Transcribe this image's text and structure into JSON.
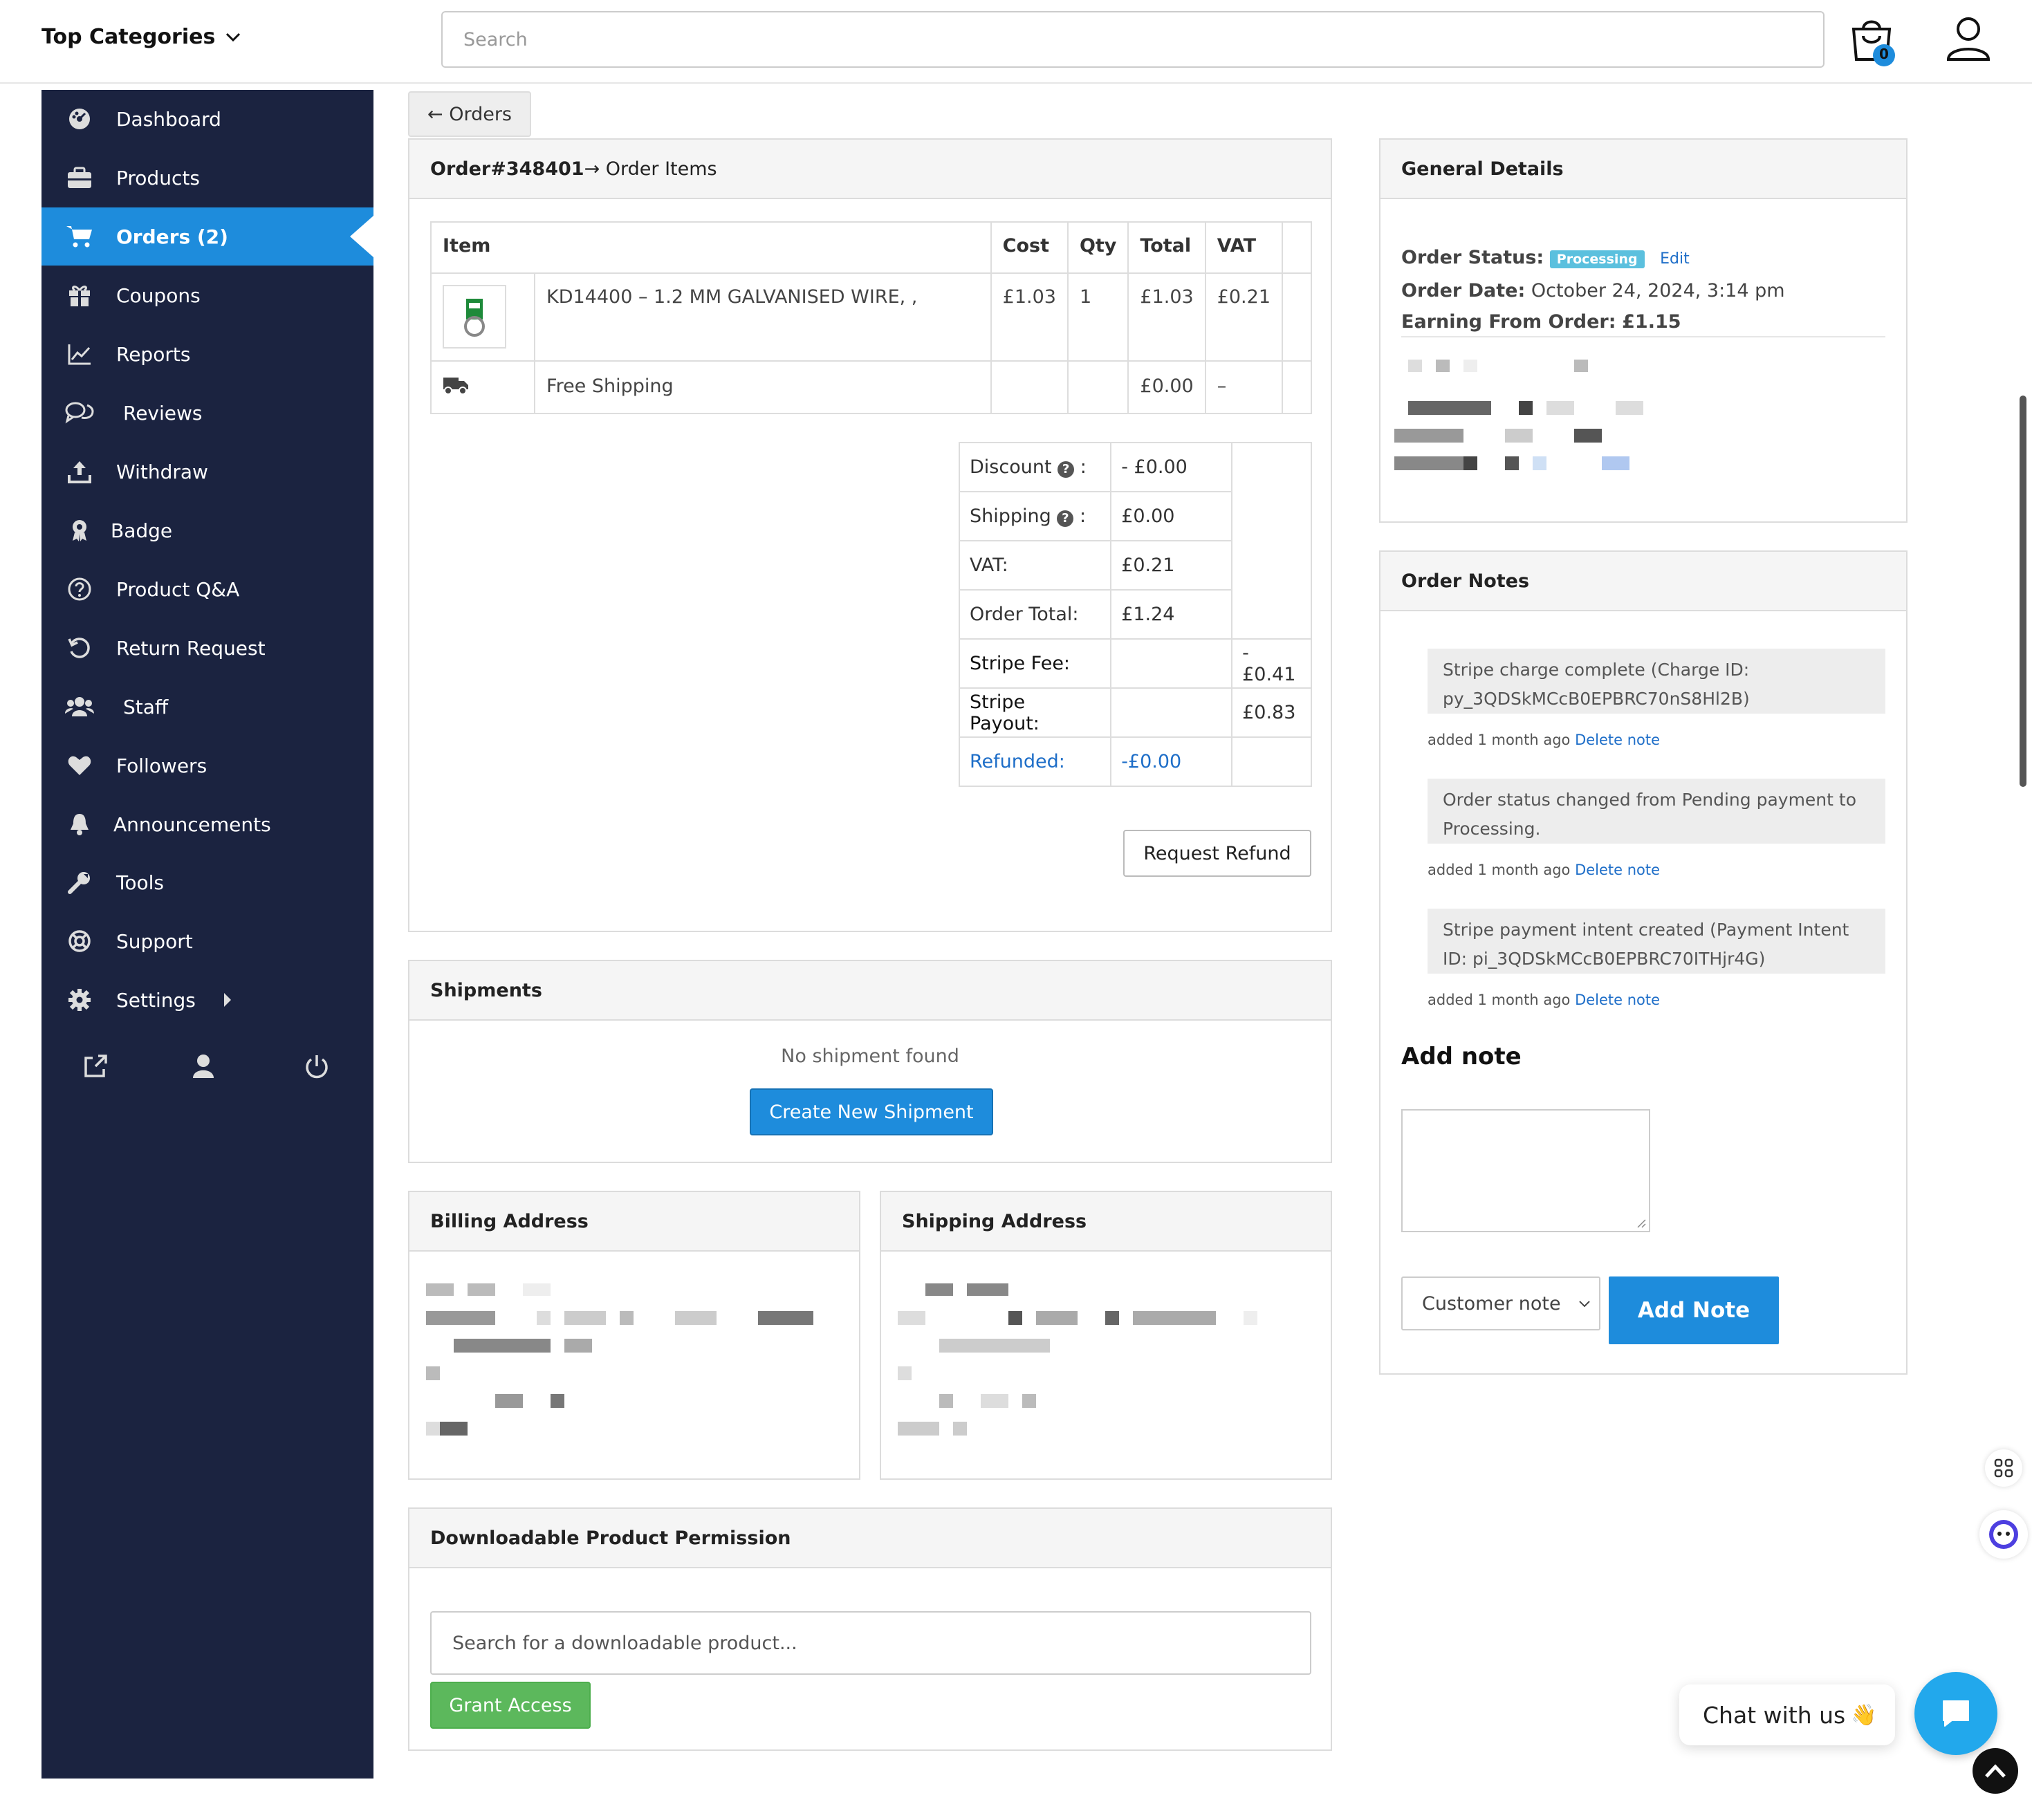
{
  "header": {
    "top_categories": "Top Categories",
    "search_placeholder": "Search",
    "cart_count": "0"
  },
  "sidebar": {
    "items": [
      {
        "label": "Dashboard",
        "icon": "dashboard-icon"
      },
      {
        "label": "Products",
        "icon": "briefcase-icon"
      },
      {
        "label": "Orders (2)",
        "icon": "cart-icon",
        "active": true
      },
      {
        "label": "Coupons",
        "icon": "gift-icon"
      },
      {
        "label": "Reports",
        "icon": "chart-line-icon"
      },
      {
        "label": "Reviews",
        "icon": "comments-icon"
      },
      {
        "label": "Withdraw",
        "icon": "upload-icon"
      },
      {
        "label": "Badge",
        "icon": "award-icon"
      },
      {
        "label": "Product Q&A",
        "icon": "question-circle-icon"
      },
      {
        "label": "Return Request",
        "icon": "undo-icon"
      },
      {
        "label": "Staff",
        "icon": "users-icon"
      },
      {
        "label": "Followers",
        "icon": "heart-icon"
      },
      {
        "label": "Announcements",
        "icon": "bell-icon"
      },
      {
        "label": "Tools",
        "icon": "wrench-icon"
      },
      {
        "label": "Support",
        "icon": "lifebuoy-icon"
      },
      {
        "label": "Settings",
        "icon": "gear-icon"
      }
    ],
    "footer_icons": [
      "external-link-icon",
      "user-icon",
      "power-icon"
    ]
  },
  "back_button": "← Orders",
  "order_items": {
    "title_bold": "Order#348401",
    "title_rest": " → Order Items",
    "columns": [
      "Item",
      "Cost",
      "Qty",
      "Total",
      "VAT"
    ],
    "product": {
      "name": "KD14400 – 1.2 MM GALVANISED WIRE, ,",
      "cost": "£1.03",
      "qty": "1",
      "total": "£1.03",
      "vat": "£0.21"
    },
    "shipping": {
      "name": "Free Shipping",
      "total": "£0.00",
      "vat": "–"
    },
    "totals": {
      "discount_label": "Discount",
      "discount_value": "- £0.00",
      "shipping_label": "Shipping",
      "shipping_value": "£0.00",
      "vat_label": "VAT:",
      "vat_value": "£0.21",
      "order_total_label": "Order Total:",
      "order_total_value": "£1.24",
      "stripe_fee_label": "Stripe Fee:",
      "stripe_fee_value": "-£0.41",
      "stripe_payout_label": "Stripe Payout:",
      "stripe_payout_value": "£0.83",
      "refunded_label": "Refunded:",
      "refunded_value": "-£0.00"
    },
    "request_refund": "Request Refund"
  },
  "shipments": {
    "title": "Shipments",
    "empty": "No shipment found",
    "create_button": "Create New Shipment"
  },
  "billing": {
    "title": "Billing Address"
  },
  "shipping_address": {
    "title": "Shipping Address"
  },
  "downloadable": {
    "title": "Downloadable Product Permission",
    "search_placeholder": "Search for a downloadable product...",
    "grant_button": "Grant Access"
  },
  "general": {
    "title": "General Details",
    "status_label": "Order Status:",
    "status_value": "Processing",
    "edit": "Edit",
    "date_label": "Order Date:",
    "date_value": "October 24, 2024, 3:14 pm",
    "earning_label": "Earning From Order:",
    "earning_value": "£1.15"
  },
  "notes": {
    "title": "Order Notes",
    "items": [
      {
        "text": "Stripe charge complete (Charge ID: py_3QDSkMCcB0EPBRC70nS8Hl2B)",
        "meta": "added 1 month ago",
        "delete": "Delete note"
      },
      {
        "text": "Order status changed from Pending payment to Processing.",
        "meta": "added 1 month ago",
        "delete": "Delete note"
      },
      {
        "text": "Stripe payment intent created (Payment Intent ID: pi_3QDSkMCcB0EPBRC70ITHjr4G)",
        "meta": "added 1 month ago",
        "delete": "Delete note"
      }
    ],
    "add_note_title": "Add note",
    "note_type": "Customer note",
    "add_button": "Add Note"
  },
  "chat": {
    "label": "Chat with us",
    "emoji": "👋"
  },
  "colors": {
    "sidebar": "#1b2340",
    "accent": "#1e8cdc",
    "status_badge": "#5bc0de",
    "grant": "#5cb85c"
  }
}
